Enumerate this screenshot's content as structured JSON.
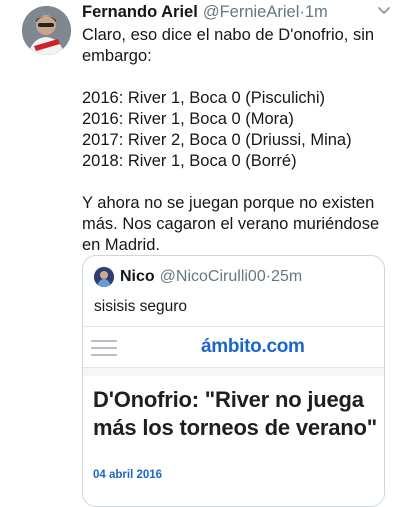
{
  "tweet": {
    "author_name": "Fernando Ariel",
    "author_handle": "@FernieAriel",
    "separator": " · ",
    "time": "1m",
    "text": "Claro, eso dice el nabo de D'onofrio, sin embargo:\n\n2016: River 1, Boca 0 (Pisculichi)\n2016: River 1, Boca 0 (Mora)\n2017: River 2, Boca 0 (Driussi, Mina)\n2018: River 1, Boca 0 (Borré)\n\nY ahora no se juegan porque no existen más. Nos cagaron el verano muriéndose en Madrid."
  },
  "quoted": {
    "author_name": "Nico",
    "author_handle": "@NicoCirulli00",
    "separator": " · ",
    "time": "25m",
    "text": "sisisis seguro",
    "card": {
      "site_logo": "ámbito.com",
      "headline": "D'Onofrio: \"River no juega\nmás los torneos de verano\"",
      "date": "04 abril 2016"
    }
  },
  "icons": {
    "chevron": "chevron-down-icon",
    "menu": "hamburger-menu-icon"
  },
  "colors": {
    "link_blue": "#1b66c9",
    "secondary_text": "#657786",
    "border": "#ccd6dd"
  }
}
